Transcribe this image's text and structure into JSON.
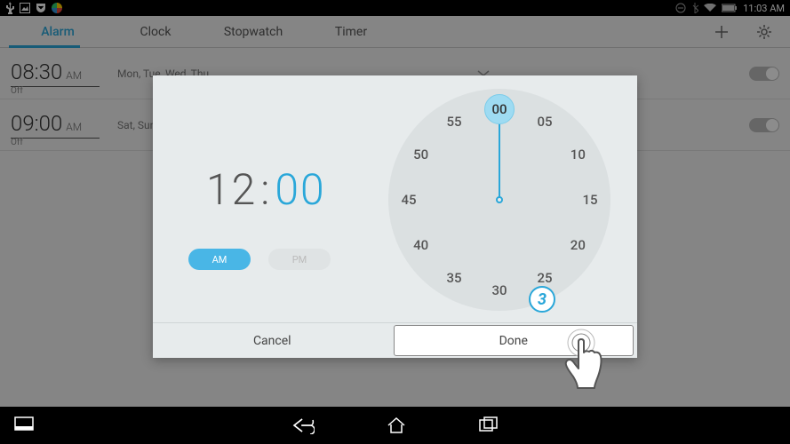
{
  "status": {
    "time": "11:03 AM"
  },
  "tabs": {
    "alarm": "Alarm",
    "clock": "Clock",
    "stopwatch": "Stopwatch",
    "timer": "Timer"
  },
  "alarms": [
    {
      "time": "08:30",
      "ampm": "AM",
      "days": "Mon, Tue, Wed, Thu...",
      "state": "Off"
    },
    {
      "time": "09:00",
      "ampm": "AM",
      "days": "Sat, Sun",
      "state": "Off"
    }
  ],
  "picker": {
    "hour": "12",
    "minute": "00",
    "am_label": "AM",
    "pm_label": "PM",
    "ticks": [
      "00",
      "05",
      "10",
      "15",
      "20",
      "25",
      "30",
      "35",
      "40",
      "45",
      "50",
      "55"
    ],
    "selected_tick": "00"
  },
  "dialog": {
    "cancel": "Cancel",
    "done": "Done"
  },
  "annotation": {
    "step": "3"
  }
}
